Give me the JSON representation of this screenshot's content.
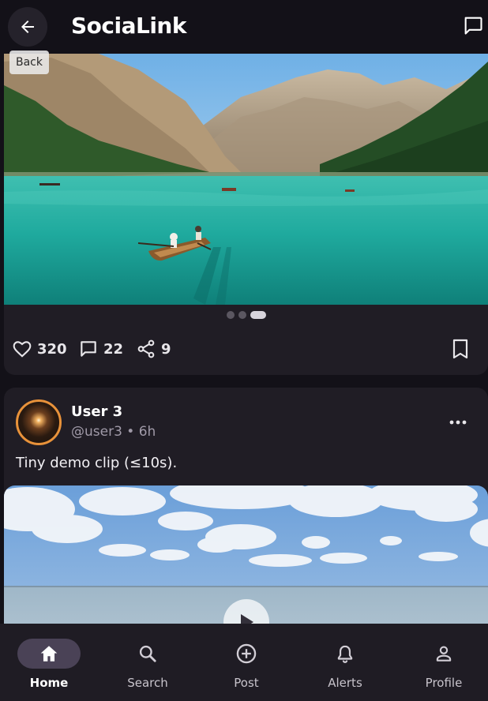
{
  "app": {
    "title": "SociaLink"
  },
  "topbar": {
    "back_tooltip": "Back"
  },
  "post1": {
    "carousel": {
      "count": 3,
      "active_index": 2
    },
    "likes": "320",
    "comments": "22",
    "shares": "9"
  },
  "post2": {
    "user_name": "User 3",
    "handle_time": "@user3 • 6h",
    "caption": "Tiny demo clip (≤10s)."
  },
  "nav": {
    "items": [
      {
        "label": "Home",
        "icon": "home-icon",
        "active": true
      },
      {
        "label": "Search",
        "icon": "search-icon",
        "active": false
      },
      {
        "label": "Post",
        "icon": "add-circle-icon",
        "active": false
      },
      {
        "label": "Alerts",
        "icon": "bell-icon",
        "active": false
      },
      {
        "label": "Profile",
        "icon": "person-icon",
        "active": false
      }
    ]
  },
  "colors": {
    "background": "#131118",
    "card": "#201d25",
    "nav_active_pill": "#4a4256",
    "avatar_ring": "#e8923a"
  }
}
